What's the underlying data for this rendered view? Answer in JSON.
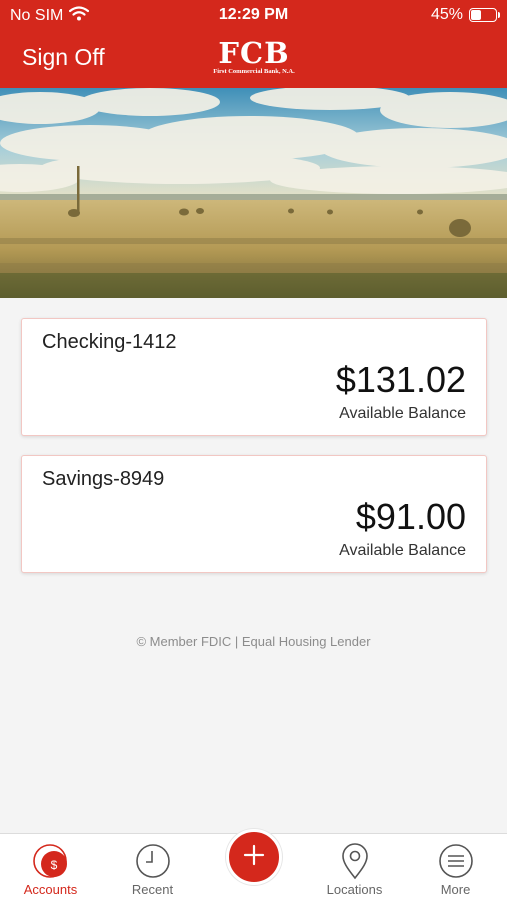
{
  "status_bar": {
    "carrier": "No SIM",
    "time": "12:29 PM",
    "battery_percent": "45%",
    "battery_level": 0.45
  },
  "header": {
    "sign_off_label": "Sign Off",
    "logo_text": "FCB",
    "logo_subtext": "First Commercial Bank, N.A."
  },
  "accounts": [
    {
      "name": "Checking-1412",
      "balance": "$131.02",
      "balance_label": "Available Balance"
    },
    {
      "name": "Savings-8949",
      "balance": "$91.00",
      "balance_label": "Available Balance"
    }
  ],
  "footer_note": "© Member FDIC | Equal Housing Lender",
  "tabs": [
    {
      "label": "Accounts",
      "icon": "dollar-circle-icon",
      "active": true
    },
    {
      "label": "Recent",
      "icon": "clock-icon",
      "active": false
    },
    {
      "label": "",
      "icon": "plus-icon",
      "active": false
    },
    {
      "label": "Locations",
      "icon": "location-pin-icon",
      "active": false
    },
    {
      "label": "More",
      "icon": "menu-circle-icon",
      "active": false
    }
  ],
  "colors": {
    "brand_red": "#d4281c",
    "background": "#f4f4f4"
  }
}
